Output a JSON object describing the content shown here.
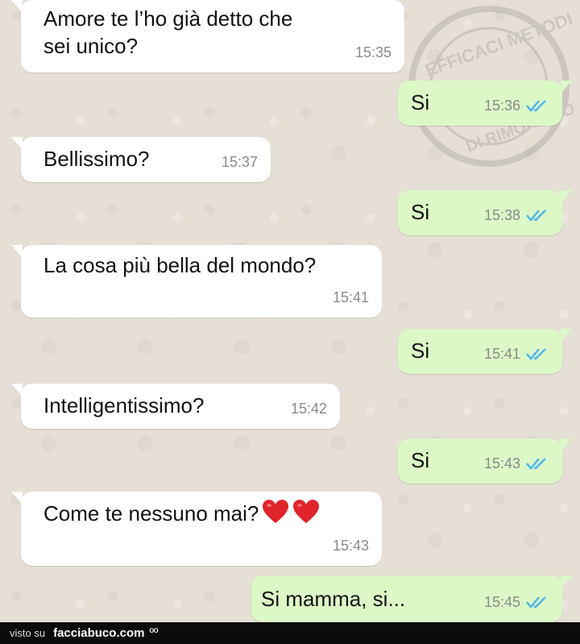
{
  "messages": [
    {
      "direction": "in",
      "text_line1": "Amore te l’ho già detto che",
      "text_line2": "sei unico?",
      "time": "15:35"
    },
    {
      "direction": "out",
      "text": "Si",
      "time": "15:36"
    },
    {
      "direction": "in",
      "text": "Bellissimo?",
      "time": "15:37"
    },
    {
      "direction": "out",
      "text": "Si",
      "time": "15:38"
    },
    {
      "direction": "in",
      "text": "La cosa più bella del mondo?",
      "time": "15:41"
    },
    {
      "direction": "out",
      "text": "Si",
      "time": "15:41"
    },
    {
      "direction": "in",
      "text": "Intelligentissimo?",
      "time": "15:42"
    },
    {
      "direction": "out",
      "text": "Si",
      "time": "15:43"
    },
    {
      "direction": "in",
      "text": "Come te nessuno mai?",
      "emoji": [
        "heart-emoji",
        "heart-emoji"
      ],
      "time": "15:43"
    },
    {
      "direction": "out",
      "text": "Si mamma, si...",
      "time": "15:45"
    }
  ],
  "watermark": {
    "line1": "EFFICACI METODI",
    "line2": "DI RIMORCHIO"
  },
  "footer": {
    "visto": "visto su",
    "site": "facciabuco.com",
    "face": "ºº"
  },
  "colors": {
    "incoming": "#ffffff",
    "outgoing": "#dcf8c6",
    "read_ticks": "#4fb6ec",
    "background": "#e6dfd5"
  }
}
